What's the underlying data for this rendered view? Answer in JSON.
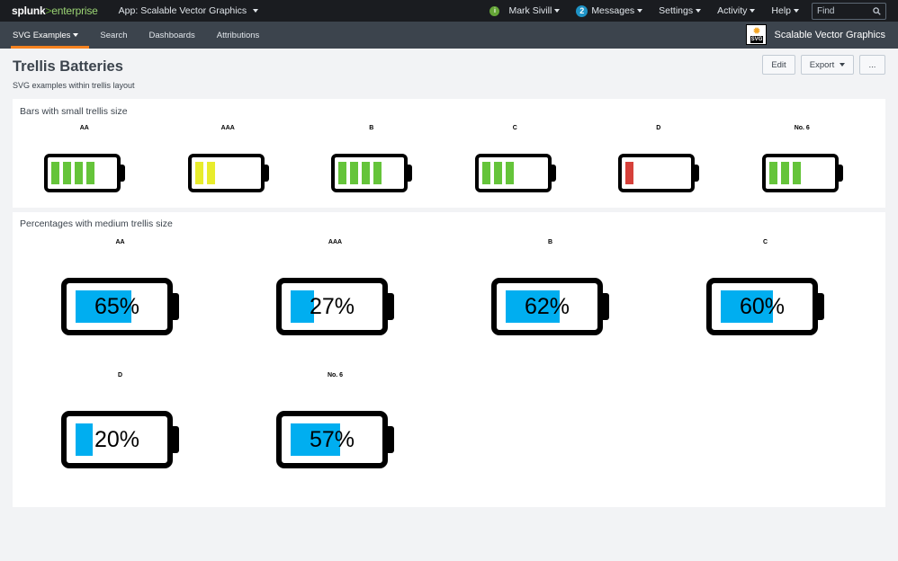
{
  "topbar": {
    "logo_splunk": "splunk",
    "logo_gt": ">",
    "logo_enterprise": "enterprise",
    "app_menu_label": "App: Scalable Vector Graphics",
    "user_status_glyph": "i",
    "user_name": "Mark Sivill",
    "messages_count": "2",
    "messages_label": "Messages",
    "settings_label": "Settings",
    "activity_label": "Activity",
    "help_label": "Help",
    "find_placeholder": "Find"
  },
  "appbar": {
    "items": [
      "SVG Examples",
      "Search",
      "Dashboards",
      "Attributions"
    ],
    "app_title": "Scalable Vector Graphics",
    "logo_text": "SVG"
  },
  "dashboard": {
    "title": "Trellis Batteries",
    "description": "SVG examples within trellis layout",
    "edit_label": "Edit",
    "export_label": "Export",
    "more_label": "..."
  },
  "panel_small": {
    "title": "Bars with small trellis size",
    "batteries": [
      {
        "label": "AA",
        "bars": 4,
        "color": "#65c43a"
      },
      {
        "label": "AAA",
        "bars": 2,
        "color": "#e8ec2c"
      },
      {
        "label": "B",
        "bars": 4,
        "color": "#65c43a"
      },
      {
        "label": "C",
        "bars": 3,
        "color": "#65c43a"
      },
      {
        "label": "D",
        "bars": 1,
        "color": "#d6403a"
      },
      {
        "label": "No. 6",
        "bars": 3,
        "color": "#65c43a"
      }
    ]
  },
  "panel_medium": {
    "title": "Percentages with medium trellis size",
    "fill_color": "#00aef0",
    "batteries": [
      {
        "label": "AA",
        "percent": 65,
        "text": "65%"
      },
      {
        "label": "AAA",
        "percent": 27,
        "text": "27%"
      },
      {
        "label": "B",
        "percent": 62,
        "text": "62%"
      },
      {
        "label": "C",
        "percent": 60,
        "text": "60%"
      },
      {
        "label": "D",
        "percent": 20,
        "text": "20%"
      },
      {
        "label": "No. 6",
        "percent": 57,
        "text": "57%"
      }
    ]
  }
}
